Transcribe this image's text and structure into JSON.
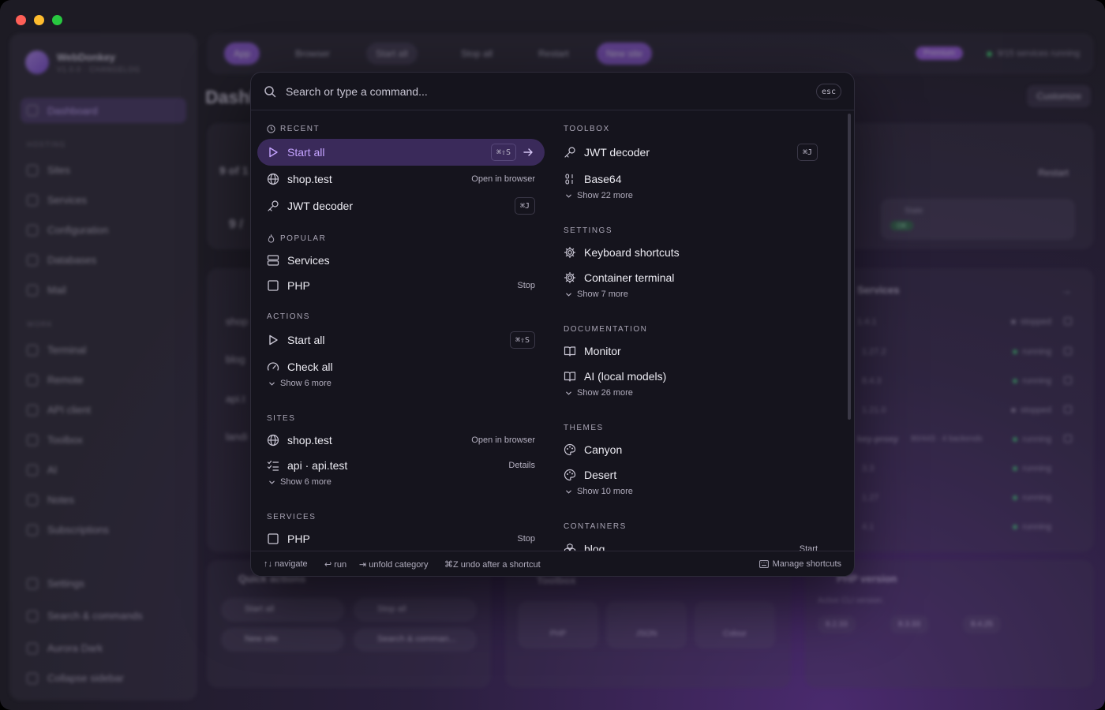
{
  "window": {
    "traffic_lights": [
      "close",
      "minimize",
      "zoom"
    ]
  },
  "app": {
    "name": "WebDonkey",
    "version": "V1.0.0 · CHANGELOG"
  },
  "sidebar": {
    "active_item": "Dashboard",
    "groups": {
      "hosting": "HOSTING",
      "work": "WORK"
    },
    "items": {
      "dashboard": "Dashboard",
      "sites": "Sites",
      "services": "Services",
      "configuration": "Configuration",
      "databases": "Databases",
      "mail": "Mail",
      "terminal": "Terminal",
      "remote": "Remote",
      "api_client": "API client",
      "toolbox": "Toolbox",
      "ai": "AI",
      "notes": "Notes",
      "subscriptions": "Subscriptions",
      "settings": "Settings",
      "search_commands": "Search & commands",
      "theme": "Aurora Dark",
      "collapse": "Collapse sidebar"
    }
  },
  "toolbar": {
    "app": "App",
    "browser": "Browser",
    "start_all": "Start all",
    "stop_all": "Stop all",
    "restart": "Restart",
    "new_site": "New site",
    "premium": "Premium",
    "running": "9/15 services running"
  },
  "dashboard": {
    "title": "Dashboard",
    "customize": "Customize",
    "restart": "Restart",
    "state_label": "State",
    "state_value": "OK",
    "count_a": "9 of 1",
    "count_b": "9 /",
    "sites": [
      "shop",
      "blog",
      "api.t",
      "landi"
    ],
    "services_title": "Services",
    "services_rows": [
      {
        "name": "1.4.1",
        "status": "stopped"
      },
      {
        "name": "1.27.2",
        "status": "running"
      },
      {
        "name": "8.4.3",
        "status": "running"
      },
      {
        "name": "1.21.0",
        "status": "stopped"
      },
      {
        "name": "key-proxy",
        "detail": "80/443 · 4 backends",
        "status": "running"
      },
      {
        "name": "3.3",
        "status": "running"
      },
      {
        "name": "1.27",
        "status": "running"
      },
      {
        "name": "4.1",
        "status": "running"
      }
    ],
    "quick_actions": {
      "title": "Quick actions",
      "start_all": "Start all",
      "stop_all": "Stop all",
      "new_site": "New site",
      "search": "Search & comman..."
    },
    "toolbox": {
      "title": "Toolbox",
      "items": [
        "PHP",
        "JSON",
        "Colour"
      ]
    },
    "php_version": {
      "title": "PHP version",
      "active_label": "Active CLI version:",
      "versions": [
        "8.2.33",
        "8.3.33",
        "8.4.25"
      ]
    }
  },
  "palette": {
    "search_placeholder": "Search or type a command...",
    "esc": "esc",
    "left": {
      "recent": {
        "title": "RECENT",
        "items": [
          {
            "label": "Start all",
            "kbd": "⌘⇧S",
            "selected": true,
            "icon": "play-icon"
          },
          {
            "label": "shop.test",
            "hint": "Open in browser",
            "icon": "globe-icon"
          },
          {
            "label": "JWT decoder",
            "kbd": "⌘J",
            "icon": "key-icon"
          }
        ]
      },
      "popular": {
        "title": "POPULAR",
        "items": [
          {
            "label": "Services",
            "icon": "server-icon"
          },
          {
            "label": "PHP",
            "hint": "Stop",
            "icon": "square-icon"
          }
        ]
      },
      "actions": {
        "title": "ACTIONS",
        "items": [
          {
            "label": "Start all",
            "kbd": "⌘⇧S",
            "icon": "play-icon"
          },
          {
            "label": "Check all",
            "icon": "gauge-icon"
          }
        ],
        "more": "Show 6 more"
      },
      "sites": {
        "title": "SITES",
        "items": [
          {
            "label": "shop.test",
            "hint": "Open in browser",
            "icon": "globe-icon"
          },
          {
            "label": "api · api.test",
            "hint": "Details",
            "icon": "checklist-icon"
          }
        ],
        "more": "Show 6 more"
      },
      "services": {
        "title": "SERVICES",
        "items": [
          {
            "label": "PHP",
            "hint": "Stop",
            "icon": "square-icon"
          }
        ]
      }
    },
    "right": {
      "toolbox": {
        "title": "TOOLBOX",
        "items": [
          {
            "label": "JWT decoder",
            "kbd": "⌘J",
            "icon": "key-icon"
          },
          {
            "label": "Base64",
            "icon": "binary-icon"
          }
        ],
        "more": "Show 22 more"
      },
      "settings": {
        "title": "SETTINGS",
        "items": [
          {
            "label": "Keyboard shortcuts",
            "icon": "gear-icon"
          },
          {
            "label": "Container terminal",
            "icon": "gear-icon"
          }
        ],
        "more": "Show 7 more"
      },
      "documentation": {
        "title": "DOCUMENTATION",
        "items": [
          {
            "label": "Monitor",
            "icon": "book-icon"
          },
          {
            "label": "AI (local models)",
            "icon": "book-icon"
          }
        ],
        "more": "Show 26 more"
      },
      "themes": {
        "title": "THEMES",
        "items": [
          {
            "label": "Canyon",
            "icon": "palette-icon"
          },
          {
            "label": "Desert",
            "icon": "palette-icon"
          }
        ],
        "more": "Show 10 more"
      },
      "containers": {
        "title": "CONTAINERS",
        "items": [
          {
            "label": "blog",
            "hint": "Start",
            "icon": "boxes-icon"
          }
        ]
      }
    },
    "footer": {
      "navigate": "↑↓ navigate",
      "run": "↩ run",
      "unfold": "⇥ unfold category",
      "undo": "⌘Z undo after a shortcut",
      "manage": "Manage shortcuts"
    }
  },
  "colors": {
    "accent": "#8f5bd9",
    "selected_row": "#3a2a5a",
    "selected_text": "#c4a3ff",
    "palette_bg": "#15141d",
    "running": "#3ec46d"
  }
}
